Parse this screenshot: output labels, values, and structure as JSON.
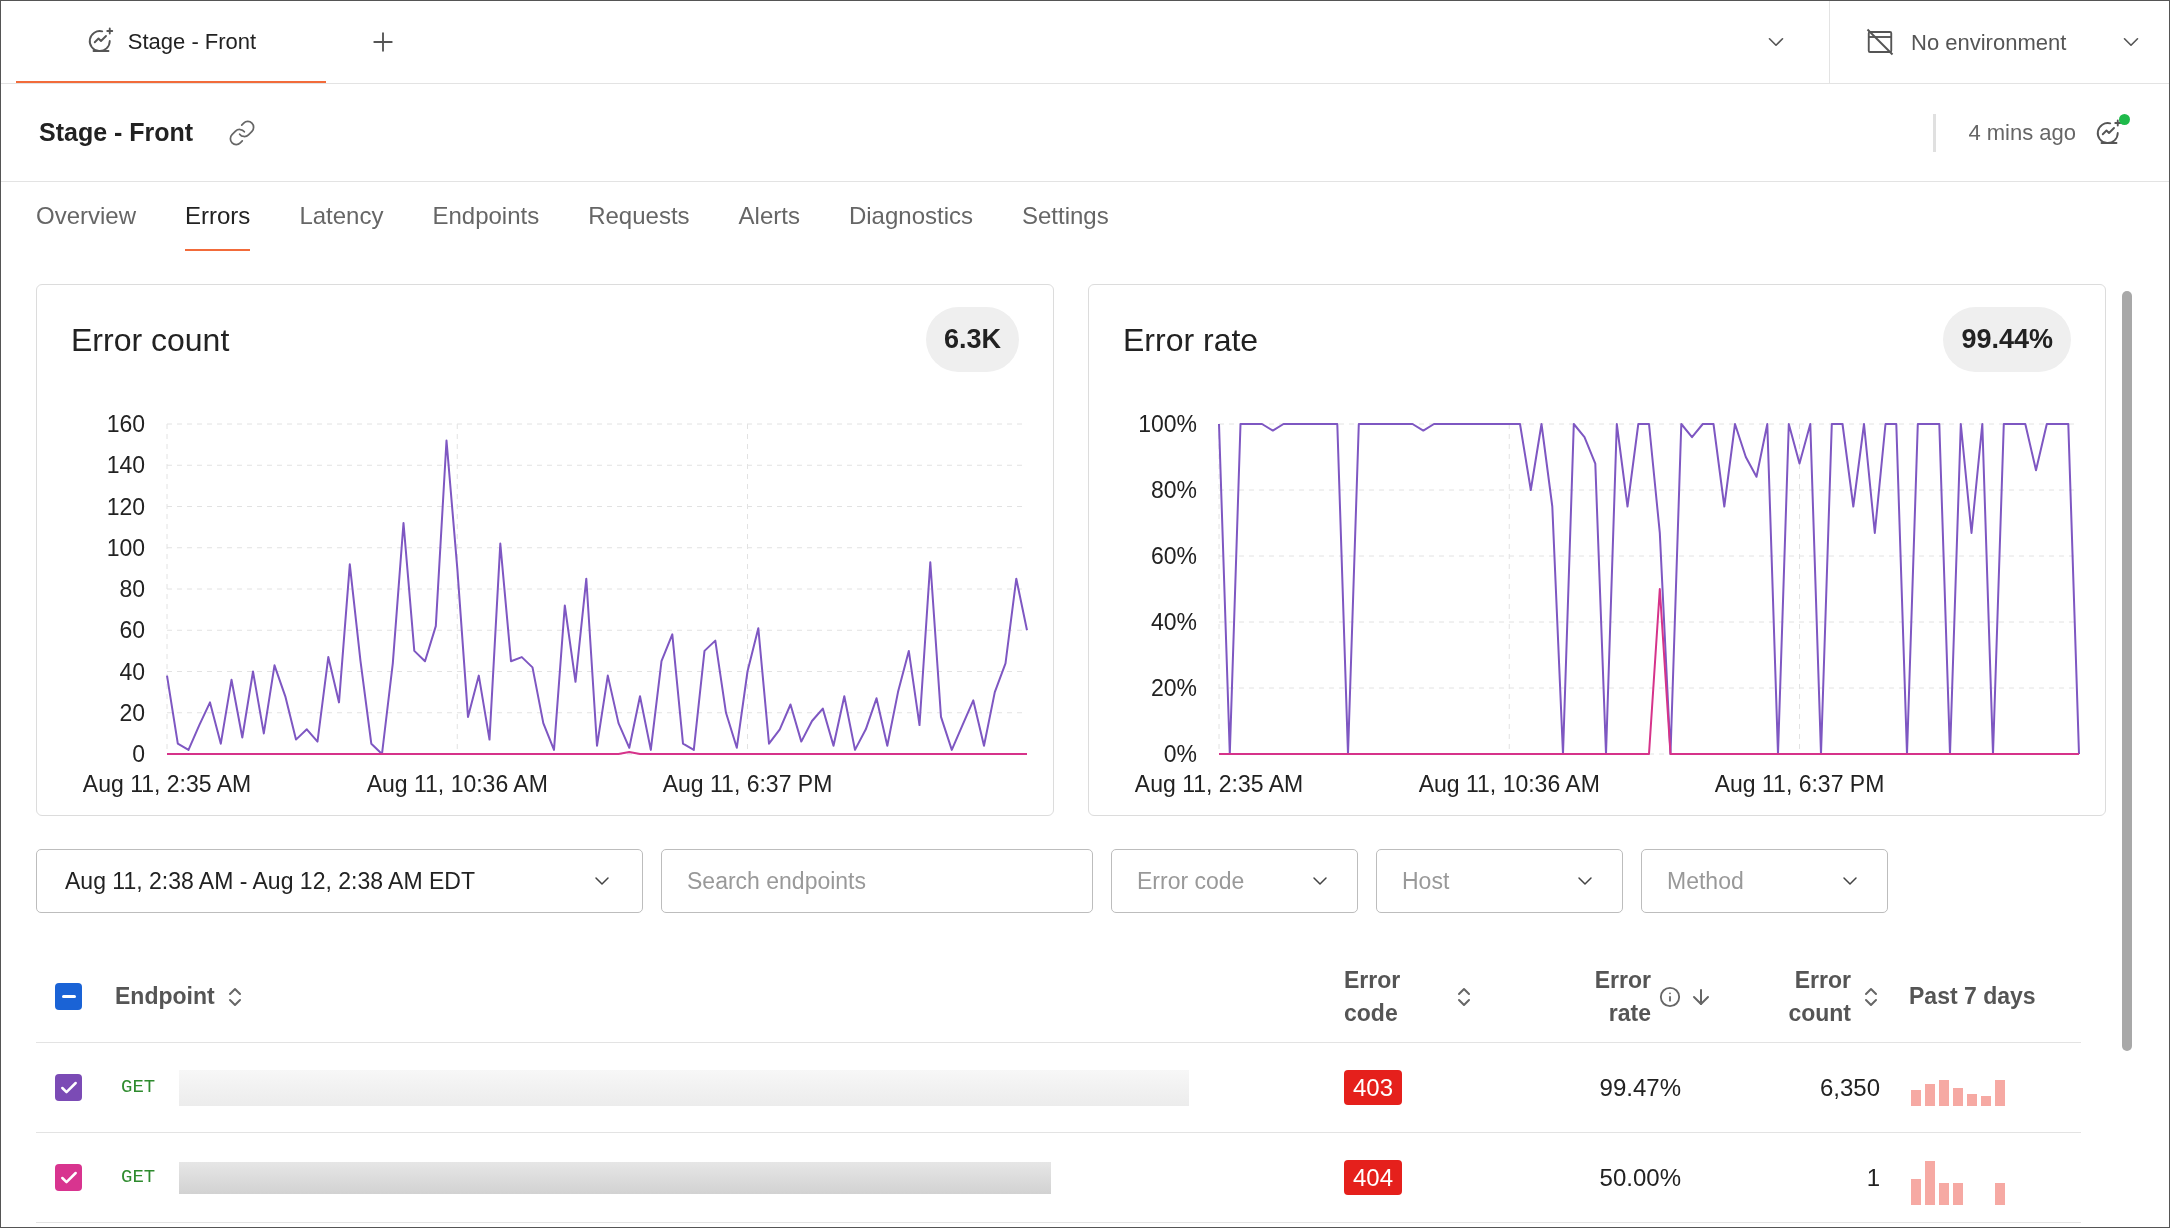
{
  "top_tabs": [
    {
      "label": "Stage - Front",
      "selected": true
    }
  ],
  "environment": {
    "label": "No environment"
  },
  "header": {
    "title": "Stage - Front",
    "updated": "4 mins ago",
    "online": true
  },
  "nav_tabs": [
    {
      "label": "Overview",
      "selected": false
    },
    {
      "label": "Errors",
      "selected": true
    },
    {
      "label": "Latency",
      "selected": false
    },
    {
      "label": "Endpoints",
      "selected": false
    },
    {
      "label": "Requests",
      "selected": false
    },
    {
      "label": "Alerts",
      "selected": false
    },
    {
      "label": "Diagnostics",
      "selected": false
    },
    {
      "label": "Settings",
      "selected": false
    }
  ],
  "cards": [
    {
      "title": "Error count",
      "badge": "6.3K",
      "chart_data": {
        "type": "line",
        "grid": true,
        "ylim": [
          0,
          160
        ],
        "yticks": [
          {
            "value": 0,
            "label": "0"
          },
          {
            "value": 20,
            "label": "20"
          },
          {
            "value": 40,
            "label": "40"
          },
          {
            "value": 60,
            "label": "60"
          },
          {
            "value": 80,
            "label": "80"
          },
          {
            "value": 100,
            "label": "100"
          },
          {
            "value": 120,
            "label": "120"
          },
          {
            "value": 140,
            "label": "140"
          },
          {
            "value": 160,
            "label": "160"
          }
        ],
        "categories": [
          "Aug 11, 2:35 AM",
          null,
          null,
          null,
          null,
          null,
          null,
          null,
          null,
          null,
          null,
          null,
          null,
          null,
          null,
          null,
          null,
          null,
          null,
          null,
          null,
          null,
          null,
          null,
          null,
          null,
          null,
          "Aug 11, 10:36 AM",
          null,
          null,
          null,
          null,
          null,
          null,
          null,
          null,
          null,
          null,
          null,
          null,
          null,
          null,
          null,
          null,
          null,
          null,
          null,
          null,
          null,
          null,
          null,
          null,
          null,
          null,
          "Aug 11, 6:37 PM",
          null,
          null,
          null,
          null,
          null,
          null,
          null,
          null,
          null,
          null,
          null,
          null,
          null,
          null,
          null,
          null,
          null,
          null,
          null,
          null,
          null,
          null,
          null,
          null,
          null,
          null
        ],
        "series": [
          {
            "color": "#7e57c2",
            "values": [
              38,
              5,
              2,
              14,
              25,
              5,
              36,
              8,
              40,
              10,
              43,
              28,
              7,
              12,
              6,
              47,
              25,
              92,
              45,
              5,
              0,
              44,
              112,
              50,
              45,
              62,
              152,
              90,
              18,
              38,
              7,
              102,
              45,
              47,
              42,
              15,
              2,
              72,
              35,
              85,
              4,
              38,
              15,
              3,
              28,
              2,
              45,
              58,
              5,
              2,
              50,
              55,
              20,
              3,
              40,
              61,
              5,
              12,
              24,
              6,
              16,
              22,
              4,
              28,
              2,
              12,
              27,
              4,
              30,
              50,
              14,
              93,
              18,
              2,
              14,
              26,
              4,
              30,
              44,
              85,
              60
            ]
          },
          {
            "color": "#d6338a",
            "values": [
              0,
              0,
              0,
              0,
              0,
              0,
              0,
              0,
              0,
              0,
              0,
              0,
              0,
              0,
              0,
              0,
              0,
              0,
              0,
              0,
              0,
              0,
              0,
              0,
              0,
              0,
              0,
              0,
              0,
              0,
              0,
              0,
              0,
              0,
              0,
              0,
              0,
              0,
              0,
              0,
              0,
              0,
              0,
              1,
              0,
              0,
              0,
              0,
              0,
              0,
              0,
              0,
              0,
              0,
              0,
              0,
              0,
              0,
              0,
              0,
              0,
              0,
              0,
              0,
              0,
              0,
              0,
              0,
              0,
              0,
              0,
              0,
              0,
              0,
              0,
              0,
              0,
              0,
              0,
              0,
              0
            ]
          }
        ]
      }
    },
    {
      "title": "Error rate",
      "badge": "99.44%",
      "chart_data": {
        "type": "line",
        "grid": true,
        "ylim": [
          0,
          100
        ],
        "yticks": [
          {
            "value": 0,
            "label": "0%"
          },
          {
            "value": 20,
            "label": "20%"
          },
          {
            "value": 40,
            "label": "40%"
          },
          {
            "value": 60,
            "label": "60%"
          },
          {
            "value": 80,
            "label": "80%"
          },
          {
            "value": 100,
            "label": "100%"
          }
        ],
        "categories": [
          "Aug 11, 2:35 AM",
          null,
          null,
          null,
          null,
          null,
          null,
          null,
          null,
          null,
          null,
          null,
          null,
          null,
          null,
          null,
          null,
          null,
          null,
          null,
          null,
          null,
          null,
          null,
          null,
          null,
          null,
          "Aug 11, 10:36 AM",
          null,
          null,
          null,
          null,
          null,
          null,
          null,
          null,
          null,
          null,
          null,
          null,
          null,
          null,
          null,
          null,
          null,
          null,
          null,
          null,
          null,
          null,
          null,
          null,
          null,
          null,
          "Aug 11, 6:37 PM",
          null,
          null,
          null,
          null,
          null,
          null,
          null,
          null,
          null,
          null,
          null,
          null,
          null,
          null,
          null,
          null,
          null,
          null,
          null,
          null,
          null,
          null,
          null,
          null,
          null,
          null
        ],
        "series": [
          {
            "color": "#7e57c2",
            "values": [
              100,
              0,
              100,
              100,
              100,
              98,
              100,
              100,
              100,
              100,
              100,
              100,
              0,
              100,
              100,
              100,
              100,
              100,
              100,
              98,
              100,
              100,
              100,
              100,
              100,
              100,
              100,
              100,
              100,
              80,
              100,
              75,
              0,
              100,
              96,
              88,
              0,
              100,
              75,
              100,
              100,
              67,
              0,
              100,
              96,
              100,
              100,
              75,
              100,
              90,
              84,
              100,
              0,
              100,
              88,
              100,
              0,
              100,
              100,
              75,
              100,
              67,
              100,
              100,
              0,
              100,
              100,
              100,
              0,
              100,
              67,
              100,
              0,
              100,
              100,
              100,
              86,
              100,
              100,
              100,
              0
            ]
          },
          {
            "color": "#d6338a",
            "values": [
              0,
              0,
              0,
              0,
              0,
              0,
              0,
              0,
              0,
              0,
              0,
              0,
              0,
              0,
              0,
              0,
              0,
              0,
              0,
              0,
              0,
              0,
              0,
              0,
              0,
              0,
              0,
              0,
              0,
              0,
              0,
              0,
              0,
              0,
              0,
              0,
              0,
              0,
              0,
              0,
              0,
              50,
              0,
              0,
              0,
              0,
              0,
              0,
              0,
              0,
              0,
              0,
              0,
              0,
              0,
              0,
              0,
              0,
              0,
              0,
              0,
              0,
              0,
              0,
              0,
              0,
              0,
              0,
              0,
              0,
              0,
              0,
              0,
              0,
              0,
              0,
              0,
              0,
              0,
              0,
              0
            ]
          }
        ]
      }
    }
  ],
  "filters": {
    "date_range": "Aug 11, 2:38 AM - Aug 12, 2:38 AM EDT",
    "search": {
      "placeholder": "Search endpoints"
    },
    "dropdowns": [
      {
        "placeholder": "Error code"
      },
      {
        "placeholder": "Host"
      },
      {
        "placeholder": "Method"
      }
    ]
  },
  "table": {
    "select_all": {
      "indeterminate": true
    },
    "columns": [
      {
        "label": "Endpoint",
        "sorted": false,
        "info": false
      },
      {
        "label": "Error code",
        "sorted": false,
        "info": false
      },
      {
        "label": "Error rate",
        "sorted": true,
        "info": true
      },
      {
        "label": "Error count",
        "sorted": false,
        "info": false
      },
      {
        "label": "Past 7 days",
        "info": false
      }
    ],
    "rows": [
      {
        "checked": true,
        "color": "#7b4bb5",
        "method": "GET",
        "error_code": "403",
        "error_rate": "99.47%",
        "error_count": "6,350"
      },
      {
        "checked": true,
        "color": "#d8348f",
        "method": "GET",
        "error_code": "404",
        "error_rate": "50.00%",
        "error_count": "1"
      }
    ]
  }
}
